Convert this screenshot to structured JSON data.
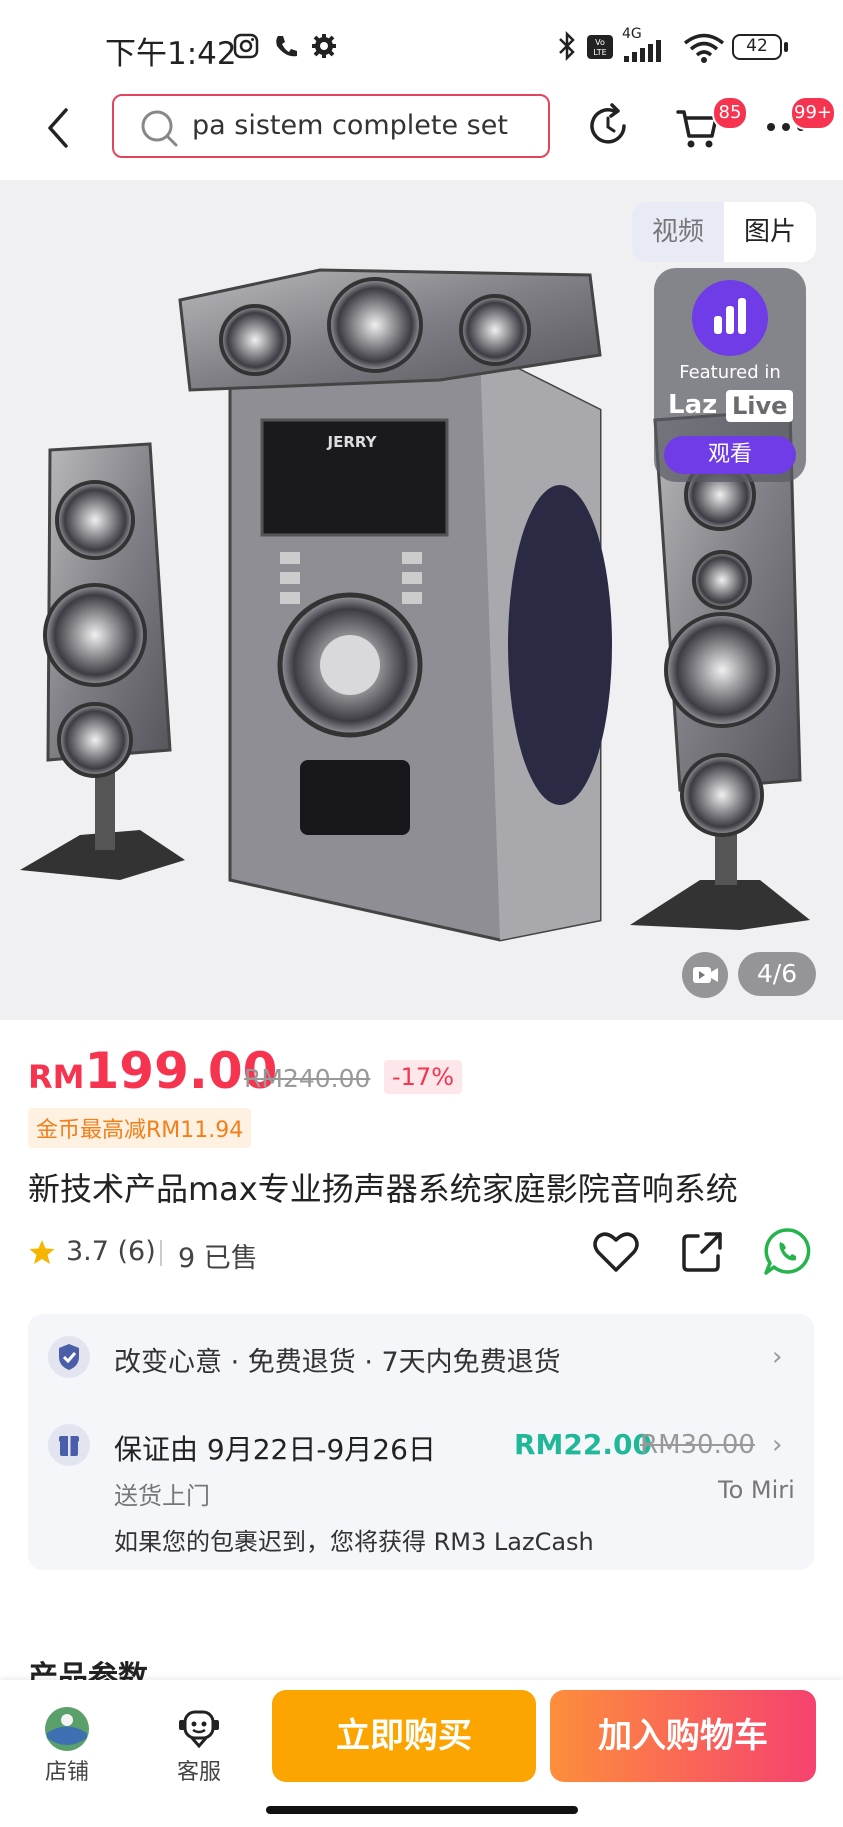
{
  "status_bar": {
    "time": "下午1:42",
    "battery": "42",
    "network": "4G"
  },
  "header": {
    "search_text": "pa sistem complete set",
    "cart_badge": "85",
    "more_badge": "99+"
  },
  "gallery": {
    "tab_video": "视频",
    "tab_image": "图片",
    "live_featured": "Featured in",
    "live_brand_a": "Laz",
    "live_brand_b": "Live",
    "live_watch": "观看",
    "counter": "4/6",
    "brand_on_product": "JERRY"
  },
  "product": {
    "currency": "RM",
    "price": "199.00",
    "original_price": "RM240.00",
    "discount": "-17%",
    "coin_promo": "金币最高减RM11.94",
    "title": "新技术产品max专业扬声器系统家庭影院音响系统",
    "rating": "3.7 (6)",
    "sold": "9 已售"
  },
  "services": {
    "return_policy": "改变心意 · 免费退货 · 7天内免费退货",
    "guarantee": "保证由 9月22日-9月26日",
    "shipping_fee": "RM22.00",
    "shipping_original": "RM30.00",
    "door_delivery": "送货上门",
    "destination": "To Miri",
    "late_compensation": "如果您的包裹迟到，您将获得 RM3 LazCash"
  },
  "specs": {
    "title": "产品参数"
  },
  "bottom_bar": {
    "store": "店铺",
    "service": "客服",
    "buy_now": "立即购买",
    "add_to_cart": "加入购物车"
  }
}
